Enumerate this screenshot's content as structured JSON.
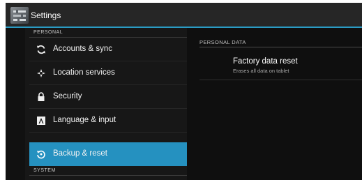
{
  "app": {
    "title": "Settings"
  },
  "sidebar": {
    "personal_header": "PERSONAL",
    "system_header": "SYSTEM",
    "items": [
      {
        "label": "Accounts & sync",
        "icon": "sync-icon"
      },
      {
        "label": "Location services",
        "icon": "location-icon"
      },
      {
        "label": "Security",
        "icon": "lock-icon"
      },
      {
        "label": "Language & input",
        "icon": "keyboard-icon"
      },
      {
        "label": "Backup & reset",
        "icon": "backup-icon",
        "selected": true
      }
    ]
  },
  "detail": {
    "section_header": "PERSONAL DATA",
    "factory_reset_title": "Factory data reset",
    "factory_reset_subtitle": "Erases all data on tablet"
  },
  "colors": {
    "accent": "#2591c0",
    "background": "#111111"
  }
}
